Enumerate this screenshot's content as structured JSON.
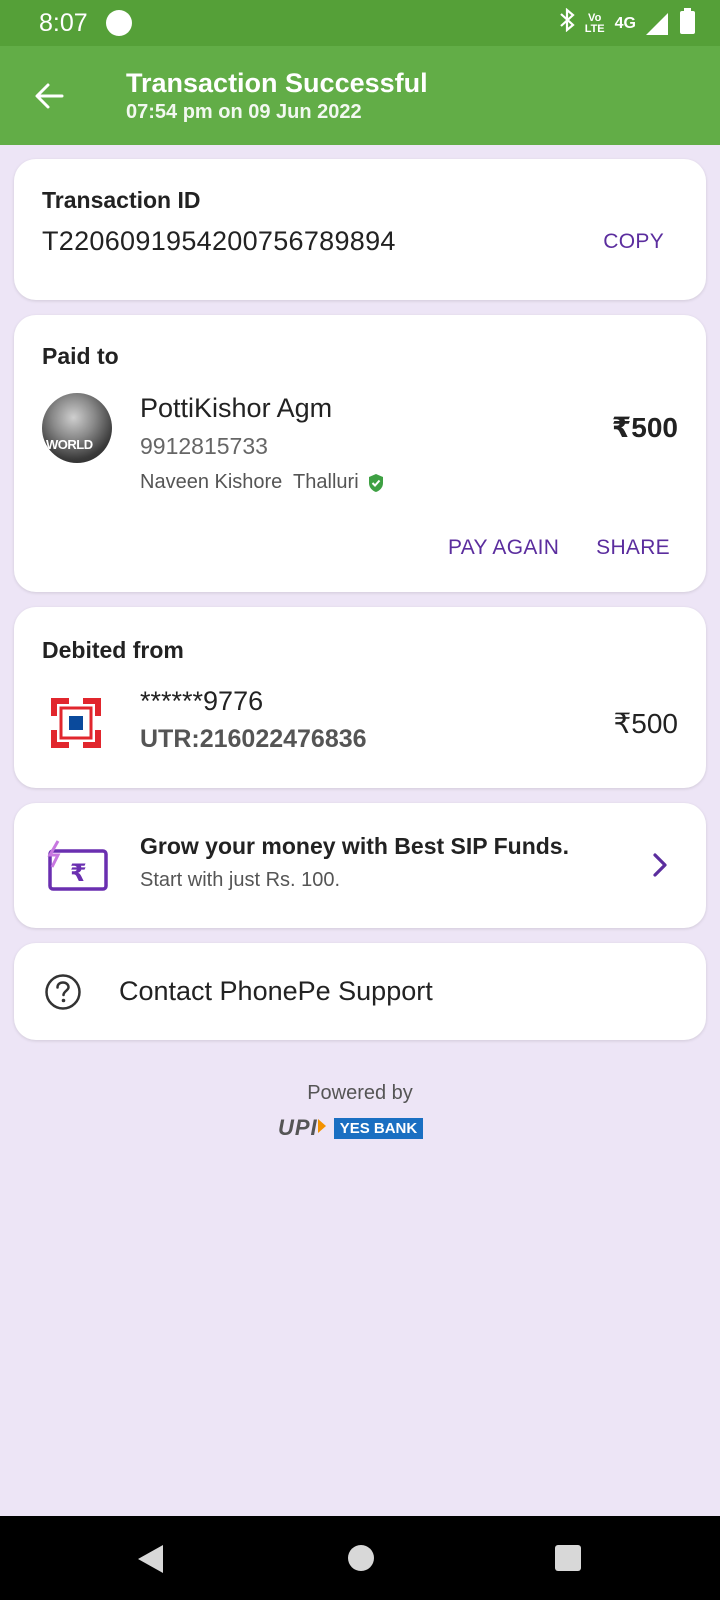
{
  "status_bar": {
    "time": "8:07",
    "volte_line1": "Vo",
    "volte_line2": "LTE",
    "network": "4G",
    "icons": [
      "notification-dot-icon",
      "bluetooth-icon",
      "volte-icon",
      "signal-icon",
      "battery-icon"
    ]
  },
  "header": {
    "title": "Transaction Successful",
    "subtitle": "07:54 pm on 09 Jun 2022",
    "back_icon": "arrow-left-icon",
    "background_color": "#62ad47",
    "status_color": "#55a038"
  },
  "transaction": {
    "label": "Transaction ID",
    "id": "T2206091954200756789894",
    "copy_label": "COPY"
  },
  "paid_to": {
    "label": "Paid to",
    "avatar_text": "WORLD",
    "name": "PottiKishor Agm",
    "phone": "9912815733",
    "verified_name": "Naveen Kishore  Thalluri",
    "amount": "₹500",
    "pay_again_label": "PAY AGAIN",
    "share_label": "SHARE"
  },
  "debited_from": {
    "label": "Debited from",
    "account": "******9776",
    "utr": "UTR:216022476836",
    "amount": "₹500",
    "bank_logo_color": "#e1262d"
  },
  "promo": {
    "title": "Grow your money with Best SIP Funds.",
    "subtitle": "Start with just Rs. 100."
  },
  "support": {
    "label": "Contact PhonePe Support"
  },
  "footer": {
    "powered_by": "Powered by",
    "upi": "UPI",
    "bank": "YES BANK"
  },
  "colors": {
    "accent": "#5b2d9e",
    "page_bg": "#ede5f6",
    "verified": "#3ea043"
  }
}
